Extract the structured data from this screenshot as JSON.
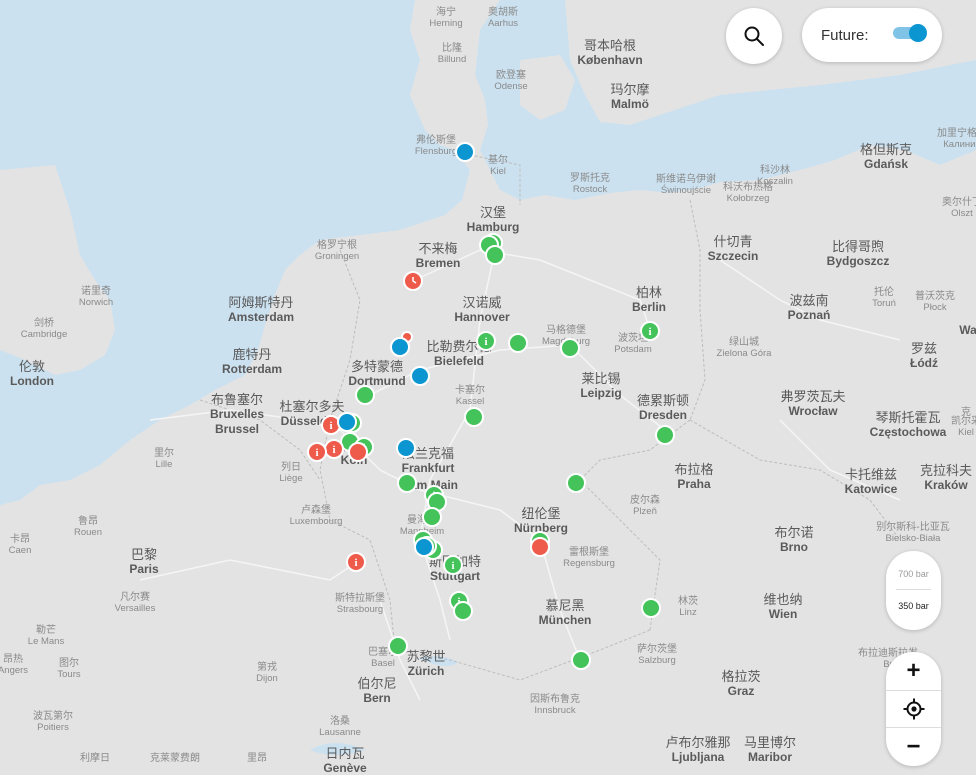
{
  "controls": {
    "future_label": "Future:",
    "future_enabled": true,
    "pressure_700": "700 bar",
    "pressure_350": "350 bar",
    "zoom_in": "+",
    "zoom_out": "−"
  },
  "colors": {
    "sea": "#cbe1f0",
    "land": "#e3e3e3",
    "available": "#43c35a",
    "unavailable": "#ee5b4b",
    "planned": "#0b95d1"
  },
  "cities": [
    {
      "cn": "海宁",
      "lat": "Herning"
    },
    {
      "cn": "奥胡斯",
      "lat": "Aarhus"
    },
    {
      "cn": "比隆",
      "lat": "Billund"
    },
    {
      "cn": "欧登塞",
      "lat": "Odense"
    },
    {
      "cn": "哥本哈根",
      "lat": "København"
    },
    {
      "cn": "玛尔摩",
      "lat": "Malmö"
    },
    {
      "cn": "弗伦斯堡",
      "lat": "Flensburg"
    },
    {
      "cn": "基尔",
      "lat": "Kiel"
    },
    {
      "cn": "罗斯托克",
      "lat": "Rostock"
    },
    {
      "cn": "斯维诺乌伊谢",
      "lat": "Świnoujście"
    },
    {
      "cn": "科沙林",
      "lat": "Koszalin"
    },
    {
      "cn": "科沃布热格",
      "lat": "Kołobrzeg"
    },
    {
      "cn": "格但斯克",
      "lat": "Gdańsk"
    },
    {
      "cn": "加里宁格勒",
      "lat": "Калинин"
    },
    {
      "cn": "奥尔什丁",
      "lat": "Olszt"
    },
    {
      "cn": "汉堡",
      "lat": "Hamburg"
    },
    {
      "cn": "格罗宁根",
      "lat": "Groningen"
    },
    {
      "cn": "不来梅",
      "lat": "Bremen"
    },
    {
      "cn": "什切青",
      "lat": "Szczecin"
    },
    {
      "cn": "比得哥煦",
      "lat": "Bydgoszcz"
    },
    {
      "cn": "托伦",
      "lat": "Toruń"
    },
    {
      "cn": "普沃茨克",
      "lat": "Płock"
    },
    {
      "cn": "诺里奇",
      "lat": "Norwich"
    },
    {
      "cn": "阿姆斯特丹",
      "lat": "Amsterdam"
    },
    {
      "cn": "汉诺威",
      "lat": "Hannover"
    },
    {
      "cn": "柏林",
      "lat": "Berlin"
    },
    {
      "cn": "波兹南",
      "lat": "Poznań"
    },
    {
      "cn": "剑桥",
      "lat": "Cambridge"
    },
    {
      "cn": "马格德堡",
      "lat": "Magdeburg"
    },
    {
      "cn": "波茨坦",
      "lat": "Potsdam"
    },
    {
      "cn": "绿山城",
      "lat": "Zielona Góra"
    },
    {
      "cn": "伦敦",
      "lat": "London"
    },
    {
      "cn": "鹿特丹",
      "lat": "Rotterdam"
    },
    {
      "cn": "比勒费尔德",
      "lat": "Bielefeld"
    },
    {
      "cn": "多特蒙德",
      "lat": "Dortmund"
    },
    {
      "cn": "莱比锡",
      "lat": "Leipzig"
    },
    {
      "cn": "罗兹",
      "lat": "Łódź"
    },
    {
      "cn": "卡塞尔",
      "lat": "Kassel"
    },
    {
      "cn": "布鲁塞尔",
      "lat": "Bruxelles"
    },
    {
      "cn": "",
      "lat": "Brussel"
    },
    {
      "cn": "杜塞尔多夫",
      "lat": "Düsseldorf"
    },
    {
      "cn": "德累斯顿",
      "lat": "Dresden"
    },
    {
      "cn": "弗罗茨瓦夫",
      "lat": "Wrocław"
    },
    {
      "cn": "琴斯托霍瓦",
      "lat": "Częstochowa"
    },
    {
      "cn": "凯尔采",
      "lat": "Kiel"
    },
    {
      "cn": "里尔",
      "lat": "Lille"
    },
    {
      "cn": "科隆",
      "lat": "Köln"
    },
    {
      "cn": "法兰克福",
      "lat": "Frankfurt"
    },
    {
      "cn": "",
      "lat": "am Main"
    },
    {
      "cn": "列日",
      "lat": "Liège"
    },
    {
      "cn": "布拉格",
      "lat": "Praha"
    },
    {
      "cn": "卡托维兹",
      "lat": "Katowice"
    },
    {
      "cn": "克拉科夫",
      "lat": "Kraków"
    },
    {
      "cn": "鲁昂",
      "lat": "Rouen"
    },
    {
      "cn": "卢森堡",
      "lat": "Luxembourg"
    },
    {
      "cn": "皮尔森",
      "lat": "Plzeň"
    },
    {
      "cn": "曼海姆",
      "lat": "Mannheim"
    },
    {
      "cn": "卡昂",
      "lat": "Caen"
    },
    {
      "cn": "纽伦堡",
      "lat": "Nürnberg"
    },
    {
      "cn": "布尔诺",
      "lat": "Brno"
    },
    {
      "cn": "别尔斯科-比亚瓦",
      "lat": "Bielsko-Biała"
    },
    {
      "cn": "巴黎",
      "lat": "Paris"
    },
    {
      "cn": "斯图加特",
      "lat": "Stuttgart"
    },
    {
      "cn": "雷根斯堡",
      "lat": "Regensburg"
    },
    {
      "cn": "凡尔赛",
      "lat": "Versailles"
    },
    {
      "cn": "斯特拉斯堡",
      "lat": "Strasbourg"
    },
    {
      "cn": "慕尼黑",
      "lat": "München"
    },
    {
      "cn": "林茨",
      "lat": "Linz"
    },
    {
      "cn": "维也纳",
      "lat": "Wien"
    },
    {
      "cn": "勒芒",
      "lat": "Le Mans"
    },
    {
      "cn": "巴塞尔",
      "lat": "Basel"
    },
    {
      "cn": "苏黎世",
      "lat": "Zürich"
    },
    {
      "cn": "萨尔茨堡",
      "lat": "Salzburg"
    },
    {
      "cn": "布拉迪斯拉发",
      "lat": "Br"
    },
    {
      "cn": "昂热",
      "lat": "Angers"
    },
    {
      "cn": "图尔",
      "lat": "Tours"
    },
    {
      "cn": "第戎",
      "lat": "Dijon"
    },
    {
      "cn": "伯尔尼",
      "lat": "Bern"
    },
    {
      "cn": "格拉茨",
      "lat": "Graz"
    },
    {
      "cn": "波瓦第尔",
      "lat": "Poitiers"
    },
    {
      "cn": "洛桑",
      "lat": "Lausanne"
    },
    {
      "cn": "因斯布鲁克",
      "lat": "Innsbruck"
    },
    {
      "cn": "利摩日",
      "lat": ""
    },
    {
      "cn": "克莱蒙费朗",
      "lat": ""
    },
    {
      "cn": "里昂",
      "lat": ""
    },
    {
      "cn": "日内瓦",
      "lat": "Genève"
    },
    {
      "cn": "卢布尔雅那",
      "lat": "Ljubljana"
    },
    {
      "cn": "马里博尔",
      "lat": "Maribor"
    },
    {
      "cn": "",
      "lat": "Wa"
    },
    {
      "cn": "克",
      "lat": ""
    }
  ],
  "stations": {
    "available": 40,
    "unavailable": 11,
    "planned": 9
  }
}
